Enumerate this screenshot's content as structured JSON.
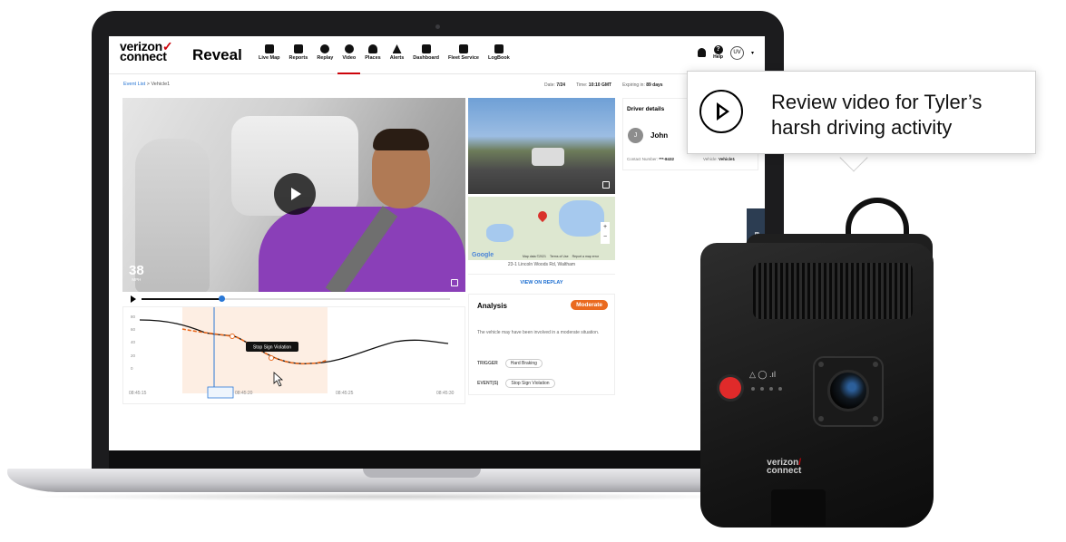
{
  "app": {
    "brand_line1": "verizon",
    "brand_line2": "connect",
    "product": "Reveal"
  },
  "nav": [
    {
      "label": "Live Map",
      "icon": "map-icon"
    },
    {
      "label": "Reports",
      "icon": "reports-icon"
    },
    {
      "label": "Replay",
      "icon": "replay-icon"
    },
    {
      "label": "Video",
      "icon": "video-icon",
      "active": true
    },
    {
      "label": "Places",
      "icon": "places-icon"
    },
    {
      "label": "Alerts",
      "icon": "alerts-icon"
    },
    {
      "label": "Dashboard",
      "icon": "dashboard-icon"
    },
    {
      "label": "Fleet Service",
      "icon": "wrench-icon"
    },
    {
      "label": "LogBook",
      "icon": "logbook-icon"
    }
  ],
  "header_right": {
    "help_label": "Help",
    "help_glyph": "?",
    "user_initials": "UV",
    "caret": "▾"
  },
  "breadcrumb": {
    "link": "Event List",
    "separator": ">",
    "current": "Vehicle1"
  },
  "meta": {
    "date_label": "Date:",
    "date_value": "7/24",
    "time_label": "Time:",
    "time_value": "10:10 GMT",
    "expiring_label": "Expiring in:",
    "expiring_value": "89 days"
  },
  "video": {
    "speed_value": "38",
    "speed_unit": "MPH",
    "progress": 0.26
  },
  "graph": {
    "y_ticks": [
      "80",
      "60",
      "40",
      "20",
      "0"
    ],
    "x_ticks": [
      "08:45:15",
      "08:45:22",
      "08:45:20",
      "08:45:25",
      "08:45:30"
    ],
    "tooltip": "Stop Sign Violation",
    "accent": "#ea6a1f",
    "marker_color": "#2a78d6"
  },
  "map": {
    "google": "Google",
    "footer": [
      "Map data ©2021",
      "Terms of Use",
      "Report a map error"
    ],
    "zoom_in": "+",
    "zoom_out": "−",
    "address": "23-1 Lincoln Woods Rd, Waltham",
    "view_replay": "VIEW ON REPLAY"
  },
  "analysis": {
    "title": "Analysis",
    "severity": "Moderate",
    "severity_color": "#ea6a1f",
    "description": "The vehicle may have been involved in a moderate situation.",
    "trigger_label": "TRIGGER",
    "trigger_value": "Hard Braking",
    "events_label": "EVENT(S)",
    "events_value": "Stop Sign Violation"
  },
  "driver": {
    "title": "Driver details",
    "initial": "J",
    "name": "John",
    "contact_label": "Contact Number:",
    "contact_value": "***-8432",
    "vehicle_label": "Vehicle:",
    "vehicle_value": "Vehicle1"
  },
  "feedback_tab": "BACK",
  "callout": {
    "text": "Review video for Tyler’s harsh driving activity"
  },
  "dashcam": {
    "brand_line1": "verizon",
    "brand_line2": "connect",
    "status_icons": "△ ◯ .ıl"
  }
}
